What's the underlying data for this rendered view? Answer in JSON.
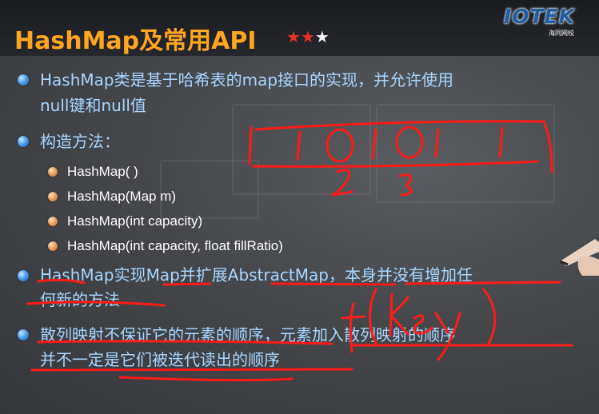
{
  "slide": {
    "title": "HashMap及常用API",
    "stars": "★★★",
    "rating_filled": 2,
    "rating_total": 3
  },
  "logo": {
    "text": "IOTEK",
    "sub": "海同网校"
  },
  "bullets": [
    {
      "line1": "HashMap类是基于哈希表的map接口的实现，并允许使用",
      "line2": "null键和null值"
    },
    {
      "line1": "构造方法："
    },
    {
      "line1": "HashMap实现Map并扩展AbstractMap，本身并没有增加任",
      "line2": "何新的方法"
    },
    {
      "line1": "散列映射不保证它的元素的顺序，元素加入散列映射的顺序",
      "line2": "并不一定是它们被迭代读出的顺序"
    }
  ],
  "constructors": [
    "HashMap( )",
    "HashMap(Map m)",
    "HashMap(int capacity)",
    "HashMap(int capacity, float fillRatio)"
  ],
  "annotations": {
    "bits": "| 1 0 1 0 1     1 |",
    "index2": "2",
    "index3": "3",
    "key": "f(key)"
  },
  "colors": {
    "title": "#ffa51f",
    "text": "#a9d6ff",
    "ink": "#ff1a1a",
    "star_filled": "#e8312a"
  }
}
